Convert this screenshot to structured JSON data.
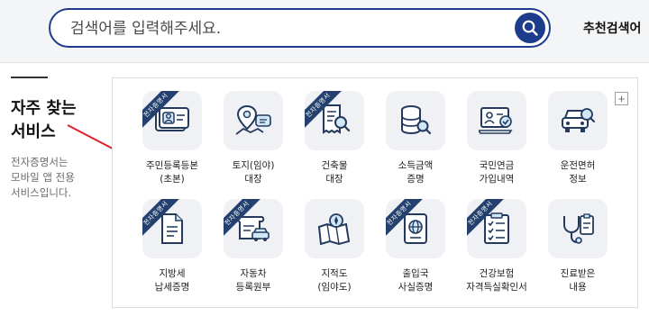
{
  "search": {
    "placeholder": "검색어를 입력해주세요.",
    "recommended_label": "추천검색어"
  },
  "side": {
    "title_line1": "자주 찾는",
    "title_line2": "서비스",
    "desc_line1": "전자증명서는",
    "desc_line2": "모바일 앱 전용",
    "desc_line3": "서비스입니다."
  },
  "badge_text": "전자증명서",
  "colors": {
    "navy": "#1e3c8c",
    "ribbon": "#24406f",
    "arrow": "#e0202a"
  },
  "services": [
    {
      "line1": "주민등록등본",
      "line2": "(초본)",
      "icon": "id-card-icon",
      "badge": true
    },
    {
      "line1": "토지(임야)",
      "line2": "대장",
      "icon": "map-pin-chat-icon",
      "badge": false
    },
    {
      "line1": "건축물",
      "line2": "대장",
      "icon": "receipt-search-icon",
      "badge": true
    },
    {
      "line1": "소득금액",
      "line2": "증명",
      "icon": "coin-stack-search-icon",
      "badge": false
    },
    {
      "line1": "국민연금",
      "line2": "가입내역",
      "icon": "monitor-id-check-icon",
      "badge": false
    },
    {
      "line1": "운전면허",
      "line2": "정보",
      "icon": "car-search-icon",
      "badge": false
    },
    {
      "line1": "지방세",
      "line2": "납세증명",
      "icon": "document-icon",
      "badge": true
    },
    {
      "line1": "자동차",
      "line2": "등록원부",
      "icon": "car-scroll-icon",
      "badge": true
    },
    {
      "line1": "지적도",
      "line2": "(임야도)",
      "icon": "map-compass-icon",
      "badge": false
    },
    {
      "line1": "출입국",
      "line2": "사실증명",
      "icon": "passport-icon",
      "badge": true
    },
    {
      "line1": "건강보험",
      "line2": "자격득실확인서",
      "icon": "checklist-icon",
      "badge": true
    },
    {
      "line1": "진료받은",
      "line2": "내용",
      "icon": "stethoscope-clipboard-icon",
      "badge": false
    }
  ]
}
